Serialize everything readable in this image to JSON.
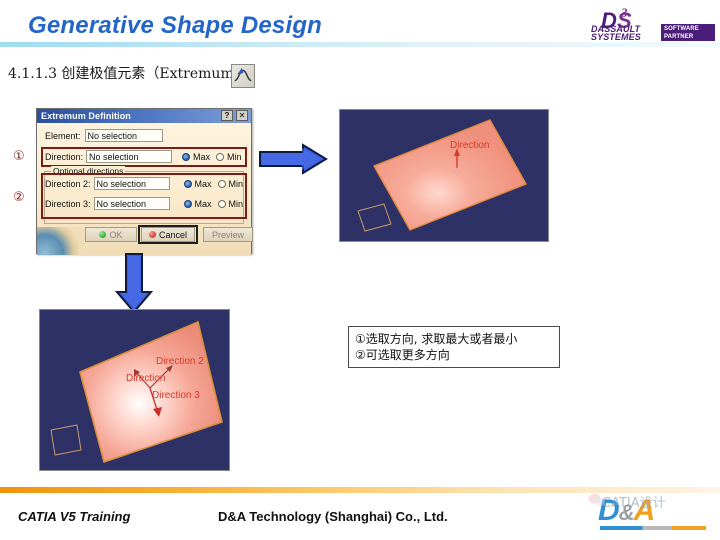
{
  "header": {
    "title": "Generative Shape Design",
    "title_color": "#2465c8",
    "rule_color": "#9fdcef",
    "logo": {
      "mark": "3DS",
      "name_line1": "DASSAULT",
      "name_line2": "SYSTEMES",
      "badge_line1": "SOFTWARE",
      "badge_line2": "PARTNER",
      "badge_color": "#4a1d7a"
    }
  },
  "section": {
    "heading": "4.1.1.3 创建极值元素（Extremum）",
    "icon_name": "extremum-icon"
  },
  "dialog": {
    "title": "Extremum Definition",
    "help_label": "?",
    "close_label": "✕",
    "element": {
      "label": "Element:",
      "value": "No selection"
    },
    "direction": {
      "label": "Direction:",
      "value": "No selection",
      "max_label": "Max",
      "min_label": "Min",
      "selected": "Max"
    },
    "optional_group_label": "Optional directions",
    "direction2": {
      "label": "Direction 2:",
      "value": "No selection",
      "max_label": "Max",
      "min_label": "Min",
      "selected": "Max"
    },
    "direction3": {
      "label": "Direction 3:",
      "value": "No selection",
      "max_label": "Max",
      "min_label": "Min",
      "selected": "Max"
    },
    "buttons": {
      "ok": "OK",
      "cancel": "Cancel",
      "preview": "Preview"
    },
    "highlight_color": "#7d1b16"
  },
  "callouts": {
    "one": "①",
    "two": "②"
  },
  "arrows": {
    "right_color": "#3a5fe0",
    "down_color": "#3a5fe0"
  },
  "viewport_top": {
    "background": "#2e3166",
    "surface_color": "#f0907e",
    "labels": [
      {
        "text": "Direction"
      }
    ]
  },
  "viewport_bottom": {
    "background": "#2e3166",
    "surface_color": "#f0907e",
    "labels": [
      {
        "text": "Direction"
      },
      {
        "text": "Direction 2"
      },
      {
        "text": "Direction 3"
      }
    ]
  },
  "note": {
    "line1": "①选取方向, 求取最大或者最小",
    "line2": "②可选取更多方向"
  },
  "footer": {
    "left": "CATIA V5 Training",
    "center": "D&A Technology (Shanghai) Co., Ltd.",
    "rule_color": "#f0930f"
  },
  "watermark": {
    "d": "D",
    "amp": "&",
    "a": "A",
    "text": "CATIA设计",
    "blue": "#2f8fd4",
    "orange": "#f0a020"
  }
}
